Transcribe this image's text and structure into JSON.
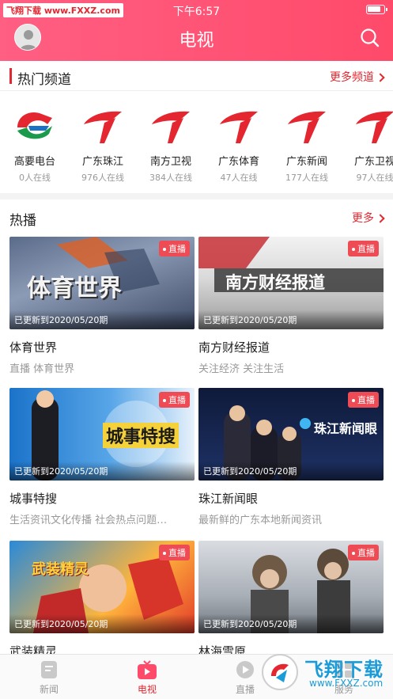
{
  "status": {
    "watermark": "飞翔下载 www.FXXZ.com",
    "time": "下午6:57",
    "battery_level": 0.85
  },
  "header": {
    "title": "电视"
  },
  "hot_channels": {
    "title": "热门频道",
    "more": "更多频道",
    "items": [
      {
        "name": "高要电台",
        "online": "0人在线",
        "logo": "gaoyao-logo"
      },
      {
        "name": "广东珠江",
        "online": "976人在线",
        "logo": "gdtv-logo"
      },
      {
        "name": "南方卫视",
        "online": "384人在线",
        "logo": "gdtv-logo"
      },
      {
        "name": "广东体育",
        "online": "47人在线",
        "logo": "gdtv-logo"
      },
      {
        "name": "广东新闻",
        "online": "177人在线",
        "logo": "gdtv-logo"
      },
      {
        "name": "广东卫视",
        "online": "97人在线",
        "logo": "gdtv-logo"
      }
    ]
  },
  "hot_play": {
    "title": "热播",
    "more": "更多",
    "cards": [
      {
        "title": "体育世界",
        "subtitle": "直播 体育世界",
        "badge": "直播",
        "update": "已更新到2020/05/20期",
        "art": "体育世界"
      },
      {
        "title": "南方财经报道",
        "subtitle": "关注经济 关注生活",
        "badge": "直播",
        "update": "已更新到2020/05/20期",
        "art": "南方财经报道"
      },
      {
        "title": "城事特搜",
        "subtitle": "生活资讯文化传播 社会热点问题…",
        "badge": "直播",
        "update": "已更新到2020/05/20期",
        "art": "城事特搜"
      },
      {
        "title": "珠江新闻眼",
        "subtitle": "最新鲜的广东本地新闻资讯",
        "badge": "直播",
        "update": "已更新到2020/05/20期",
        "art": "珠江新闻眼"
      },
      {
        "title": "武装精灵",
        "subtitle": "",
        "badge": "直播",
        "update": "已更新到2020/05/20期",
        "art": "武装精灵"
      },
      {
        "title": "林海雪原",
        "subtitle": "",
        "badge": "直播",
        "update": "已更新到2020/05/20期",
        "art": ""
      }
    ]
  },
  "tabbar": {
    "items": [
      {
        "label": "新闻",
        "icon": "news-icon"
      },
      {
        "label": "电视",
        "icon": "tv-icon"
      },
      {
        "label": "直播",
        "icon": "play-icon"
      },
      {
        "label": "服务",
        "icon": "service-icon"
      }
    ],
    "active": "电视"
  },
  "watermark_br": {
    "brand": "飞翔下载",
    "url": "www.FXXZ.com"
  },
  "colors": {
    "accent": "#e3262f",
    "header": "#ff5573",
    "badge": "#ef4b55"
  }
}
